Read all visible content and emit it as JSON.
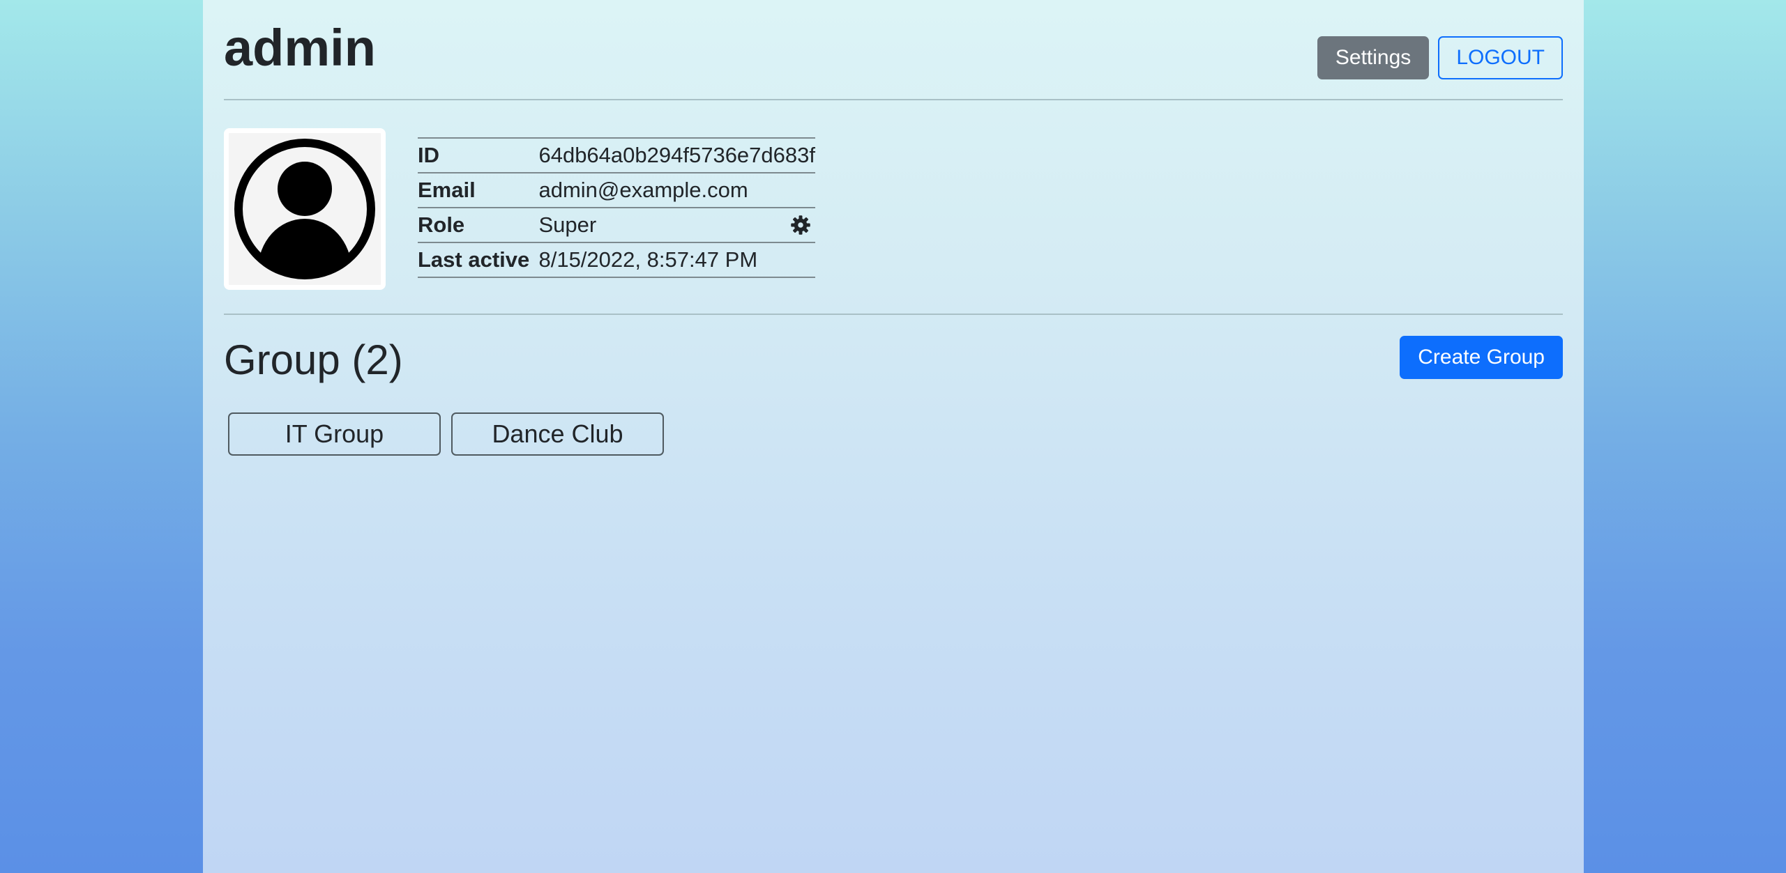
{
  "header": {
    "title": "admin",
    "settings_label": "Settings",
    "logout_label": "LOGOUT"
  },
  "profile": {
    "avatar_icon": "user-circle-icon",
    "fields": [
      {
        "label": "ID",
        "value": "64db64a0b294f5736e7d683f"
      },
      {
        "label": "Email",
        "value": "admin@example.com"
      },
      {
        "label": "Role",
        "value": "Super",
        "icon": "gear-icon"
      },
      {
        "label": "Last active",
        "value": "8/15/2022, 8:57:47 PM"
      }
    ]
  },
  "groups": {
    "title": "Group (2)",
    "create_label": "Create Group",
    "items": [
      {
        "label": "IT Group"
      },
      {
        "label": "Dance Club"
      }
    ]
  },
  "colors": {
    "primary": "#0d6efd",
    "secondary": "#6c757d"
  }
}
